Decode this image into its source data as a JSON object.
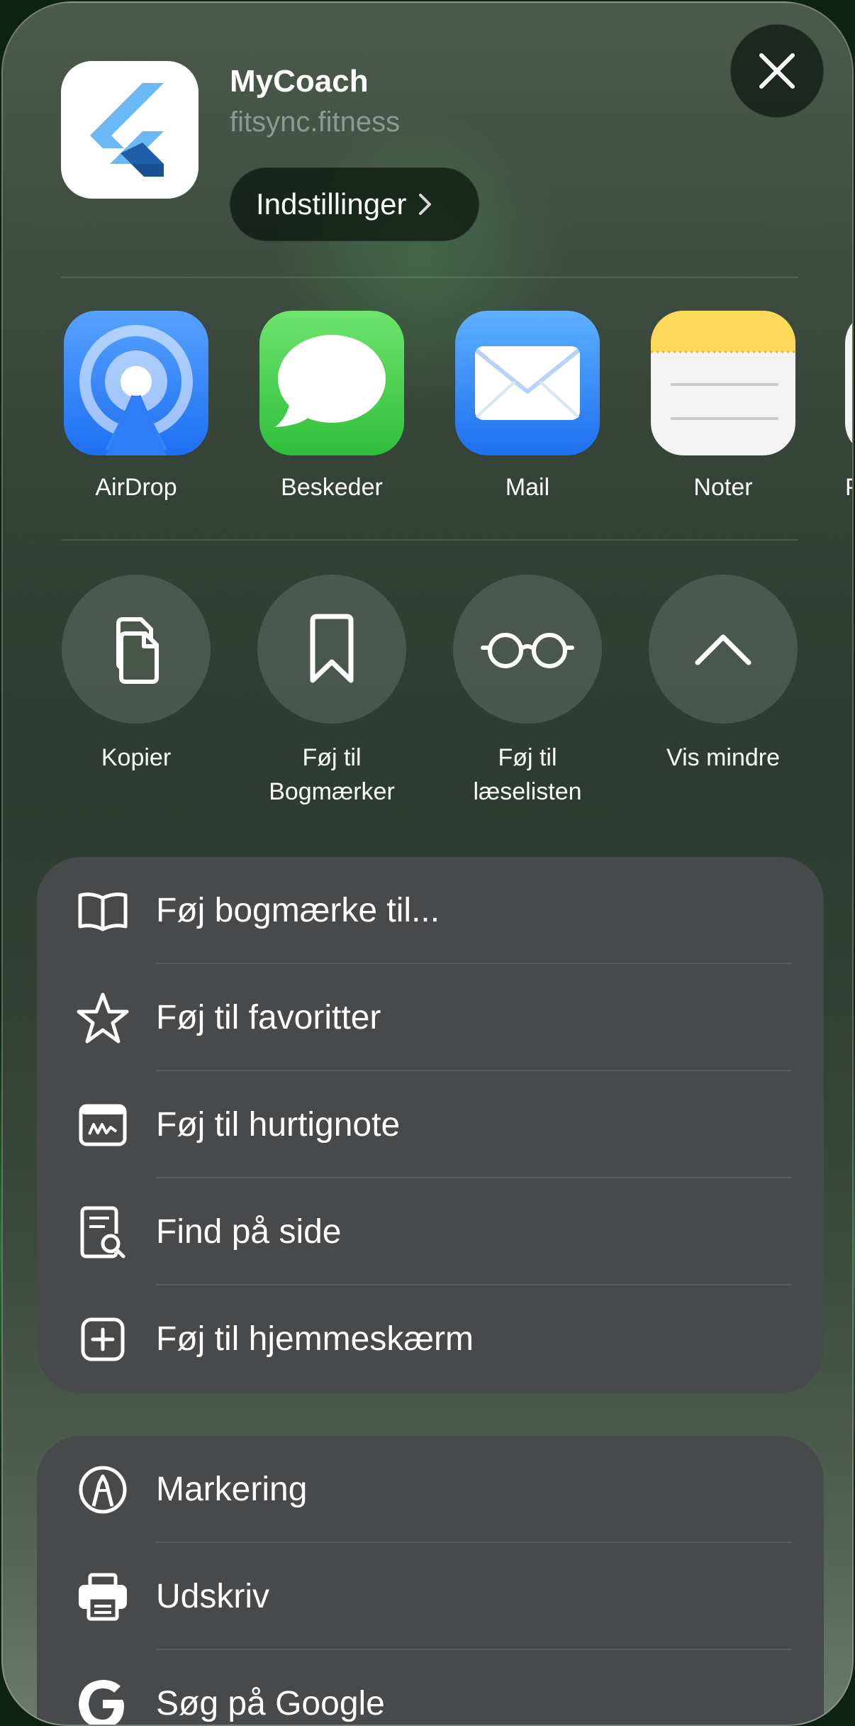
{
  "app": {
    "name": "MyCoach",
    "domain": "fitsync.fitness",
    "settings_label": "Indstillinger"
  },
  "share_apps": [
    {
      "label": "AirDrop",
      "icon": "airdrop-icon"
    },
    {
      "label": "Beskeder",
      "icon": "messages-icon"
    },
    {
      "label": "Mail",
      "icon": "mail-icon"
    },
    {
      "label": "Noter",
      "icon": "notes-icon"
    },
    {
      "label": "P",
      "icon": "partial-app-icon"
    }
  ],
  "actions": [
    {
      "line1": "Kopier",
      "line2": "",
      "icon": "copy-icon"
    },
    {
      "line1": "Føj til",
      "line2": "Bogmærker",
      "icon": "bookmark-icon"
    },
    {
      "line1": "Føj til",
      "line2": "læselisten",
      "icon": "reading-glasses-icon"
    },
    {
      "line1": "Vis mindre",
      "line2": "",
      "icon": "chevron-up-icon"
    }
  ],
  "menu_group_1": [
    {
      "label": "Føj bogmærke til...",
      "icon": "book-icon"
    },
    {
      "label": "Føj til favoritter",
      "icon": "star-icon"
    },
    {
      "label": "Føj til hurtignote",
      "icon": "quick-note-icon"
    },
    {
      "label": "Find på side",
      "icon": "find-on-page-icon"
    },
    {
      "label": "Føj til hjemmeskærm",
      "icon": "add-square-icon"
    }
  ],
  "menu_group_2": [
    {
      "label": "Markering",
      "icon": "markup-pen-icon"
    },
    {
      "label": "Udskriv",
      "icon": "printer-icon"
    },
    {
      "label": "Søg på Google",
      "icon": "google-icon"
    }
  ],
  "colors": {
    "list_background": "#48494b",
    "airdrop": "#2f7df6",
    "messages": "#3fd251",
    "mail": "#2f7df6",
    "notes_header": "#fcd959"
  }
}
